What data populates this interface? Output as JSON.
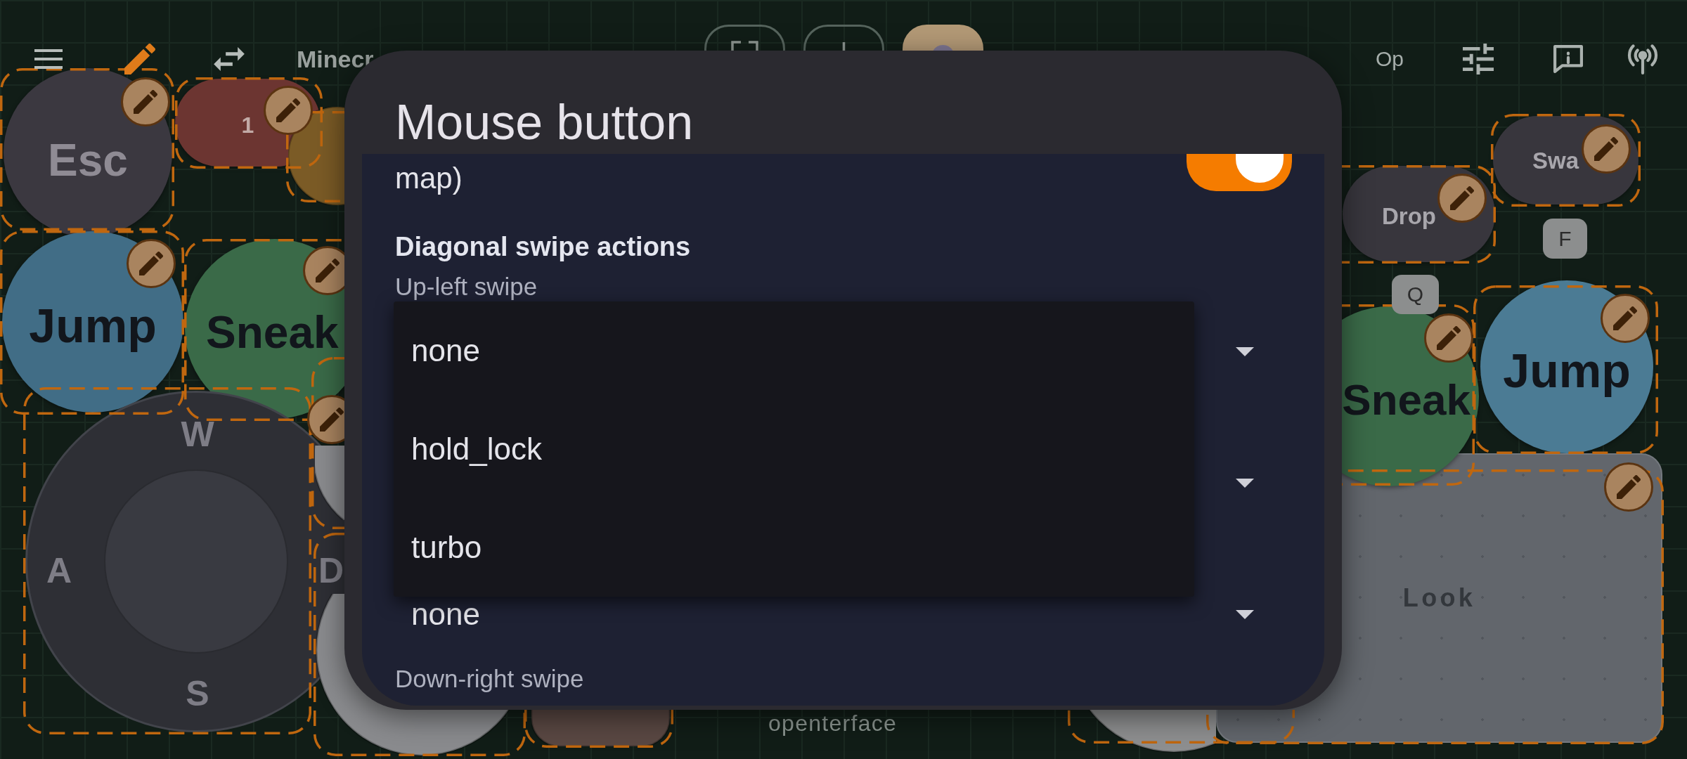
{
  "top_bar": {
    "edit_mode": true,
    "title": "Minecr",
    "toolbar_buttons": [
      {
        "selected": false
      },
      {
        "selected": false
      },
      {
        "selected": true
      }
    ],
    "mode_label": "Op"
  },
  "canvas": {
    "controls": [
      {
        "kind": "round",
        "label": "Esc"
      },
      {
        "kind": "pill",
        "label": "1"
      },
      {
        "kind": "pill",
        "label": "Swa"
      },
      {
        "kind": "round"
      },
      {
        "kind": "pill",
        "label": "Drop"
      },
      {
        "kind": "key",
        "label": "F"
      },
      {
        "kind": "round",
        "label": "Jump"
      },
      {
        "kind": "round",
        "label": "Sneak"
      },
      {
        "kind": "key",
        "label": "Q"
      },
      {
        "kind": "round",
        "label": "Jump"
      },
      {
        "kind": "round",
        "label": "Sneak"
      },
      {
        "kind": "round"
      },
      {
        "kind": "joystick",
        "keys": [
          "W",
          "A",
          "S",
          "D"
        ]
      },
      {
        "kind": "round"
      },
      {
        "kind": "pill"
      },
      {
        "kind": "round"
      },
      {
        "kind": "pad",
        "label": "Look"
      }
    ],
    "logo": "openterface"
  },
  "dialog": {
    "title": "Mouse button",
    "toggle": {
      "label": "map)",
      "on": true
    },
    "section_title": "Diagonal swipe actions",
    "rows": [
      {
        "kind": "label",
        "text": "Up-left swipe"
      },
      {
        "kind": "dropdown"
      },
      {
        "kind": "dropdown"
      },
      {
        "kind": "dropdown",
        "value": "none"
      },
      {
        "kind": "label",
        "text": "Down-right swipe"
      }
    ],
    "menu": {
      "options": [
        {
          "text": "none",
          "selected": false
        },
        {
          "text": "hold_lock",
          "selected": false
        },
        {
          "text": "turbo",
          "selected": false
        }
      ]
    }
  }
}
